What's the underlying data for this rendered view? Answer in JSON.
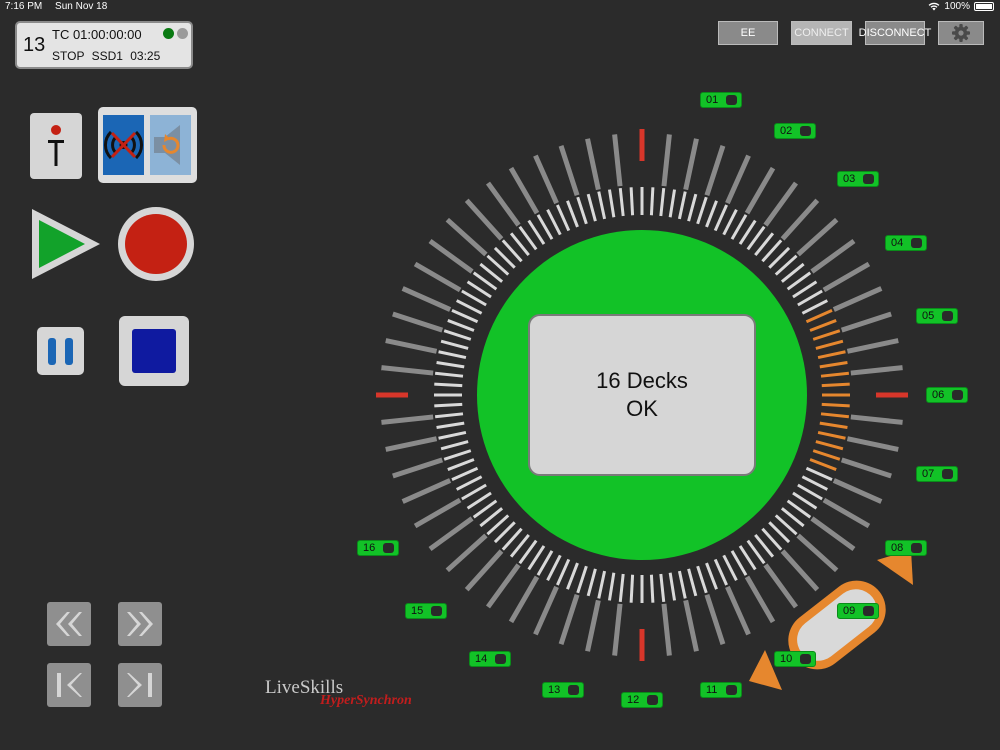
{
  "status_bar": {
    "time": "7:16 PM",
    "date": "Sun Nov 18",
    "battery": "100%"
  },
  "timecode_box": {
    "channel": "13",
    "timecode": "TC 01:00:00:00",
    "status": "STOP  SSD1  03:25",
    "indicator_colors": [
      "#0a7a12",
      "#9a9a9a"
    ]
  },
  "top_buttons": {
    "ee": "EE",
    "connect": "CONNECT",
    "disconnect": "DISCONNECT",
    "settings_icon": "gear-icon"
  },
  "transport": {
    "tape_icon": "tape-transport-icon",
    "sync_icon": "sync-reload-icon",
    "play_icon": "play-icon",
    "record_icon": "record-icon",
    "pause_icon": "pause-icon",
    "stop_icon": "stop-icon",
    "rewind_icon": "rewind-icon",
    "fast_forward_icon": "fast-forward-icon",
    "skip_back_icon": "skip-back-icon",
    "skip_forward_icon": "skip-forward-icon"
  },
  "logo": {
    "line1": "LiveSkills",
    "line2": "HyperSynchron"
  },
  "decks": [
    "01",
    "02",
    "03",
    "04",
    "05",
    "06",
    "07",
    "08",
    "09",
    "10",
    "11",
    "12",
    "13",
    "14",
    "15",
    "16"
  ],
  "display": {
    "line1": "16 Decks",
    "line2": "OK"
  },
  "dial_colors": {
    "green": "#12c227",
    "orange": "#e6872e",
    "red": "#d7362a",
    "gray": "#8a8a8a",
    "light": "#d9d9d9"
  }
}
